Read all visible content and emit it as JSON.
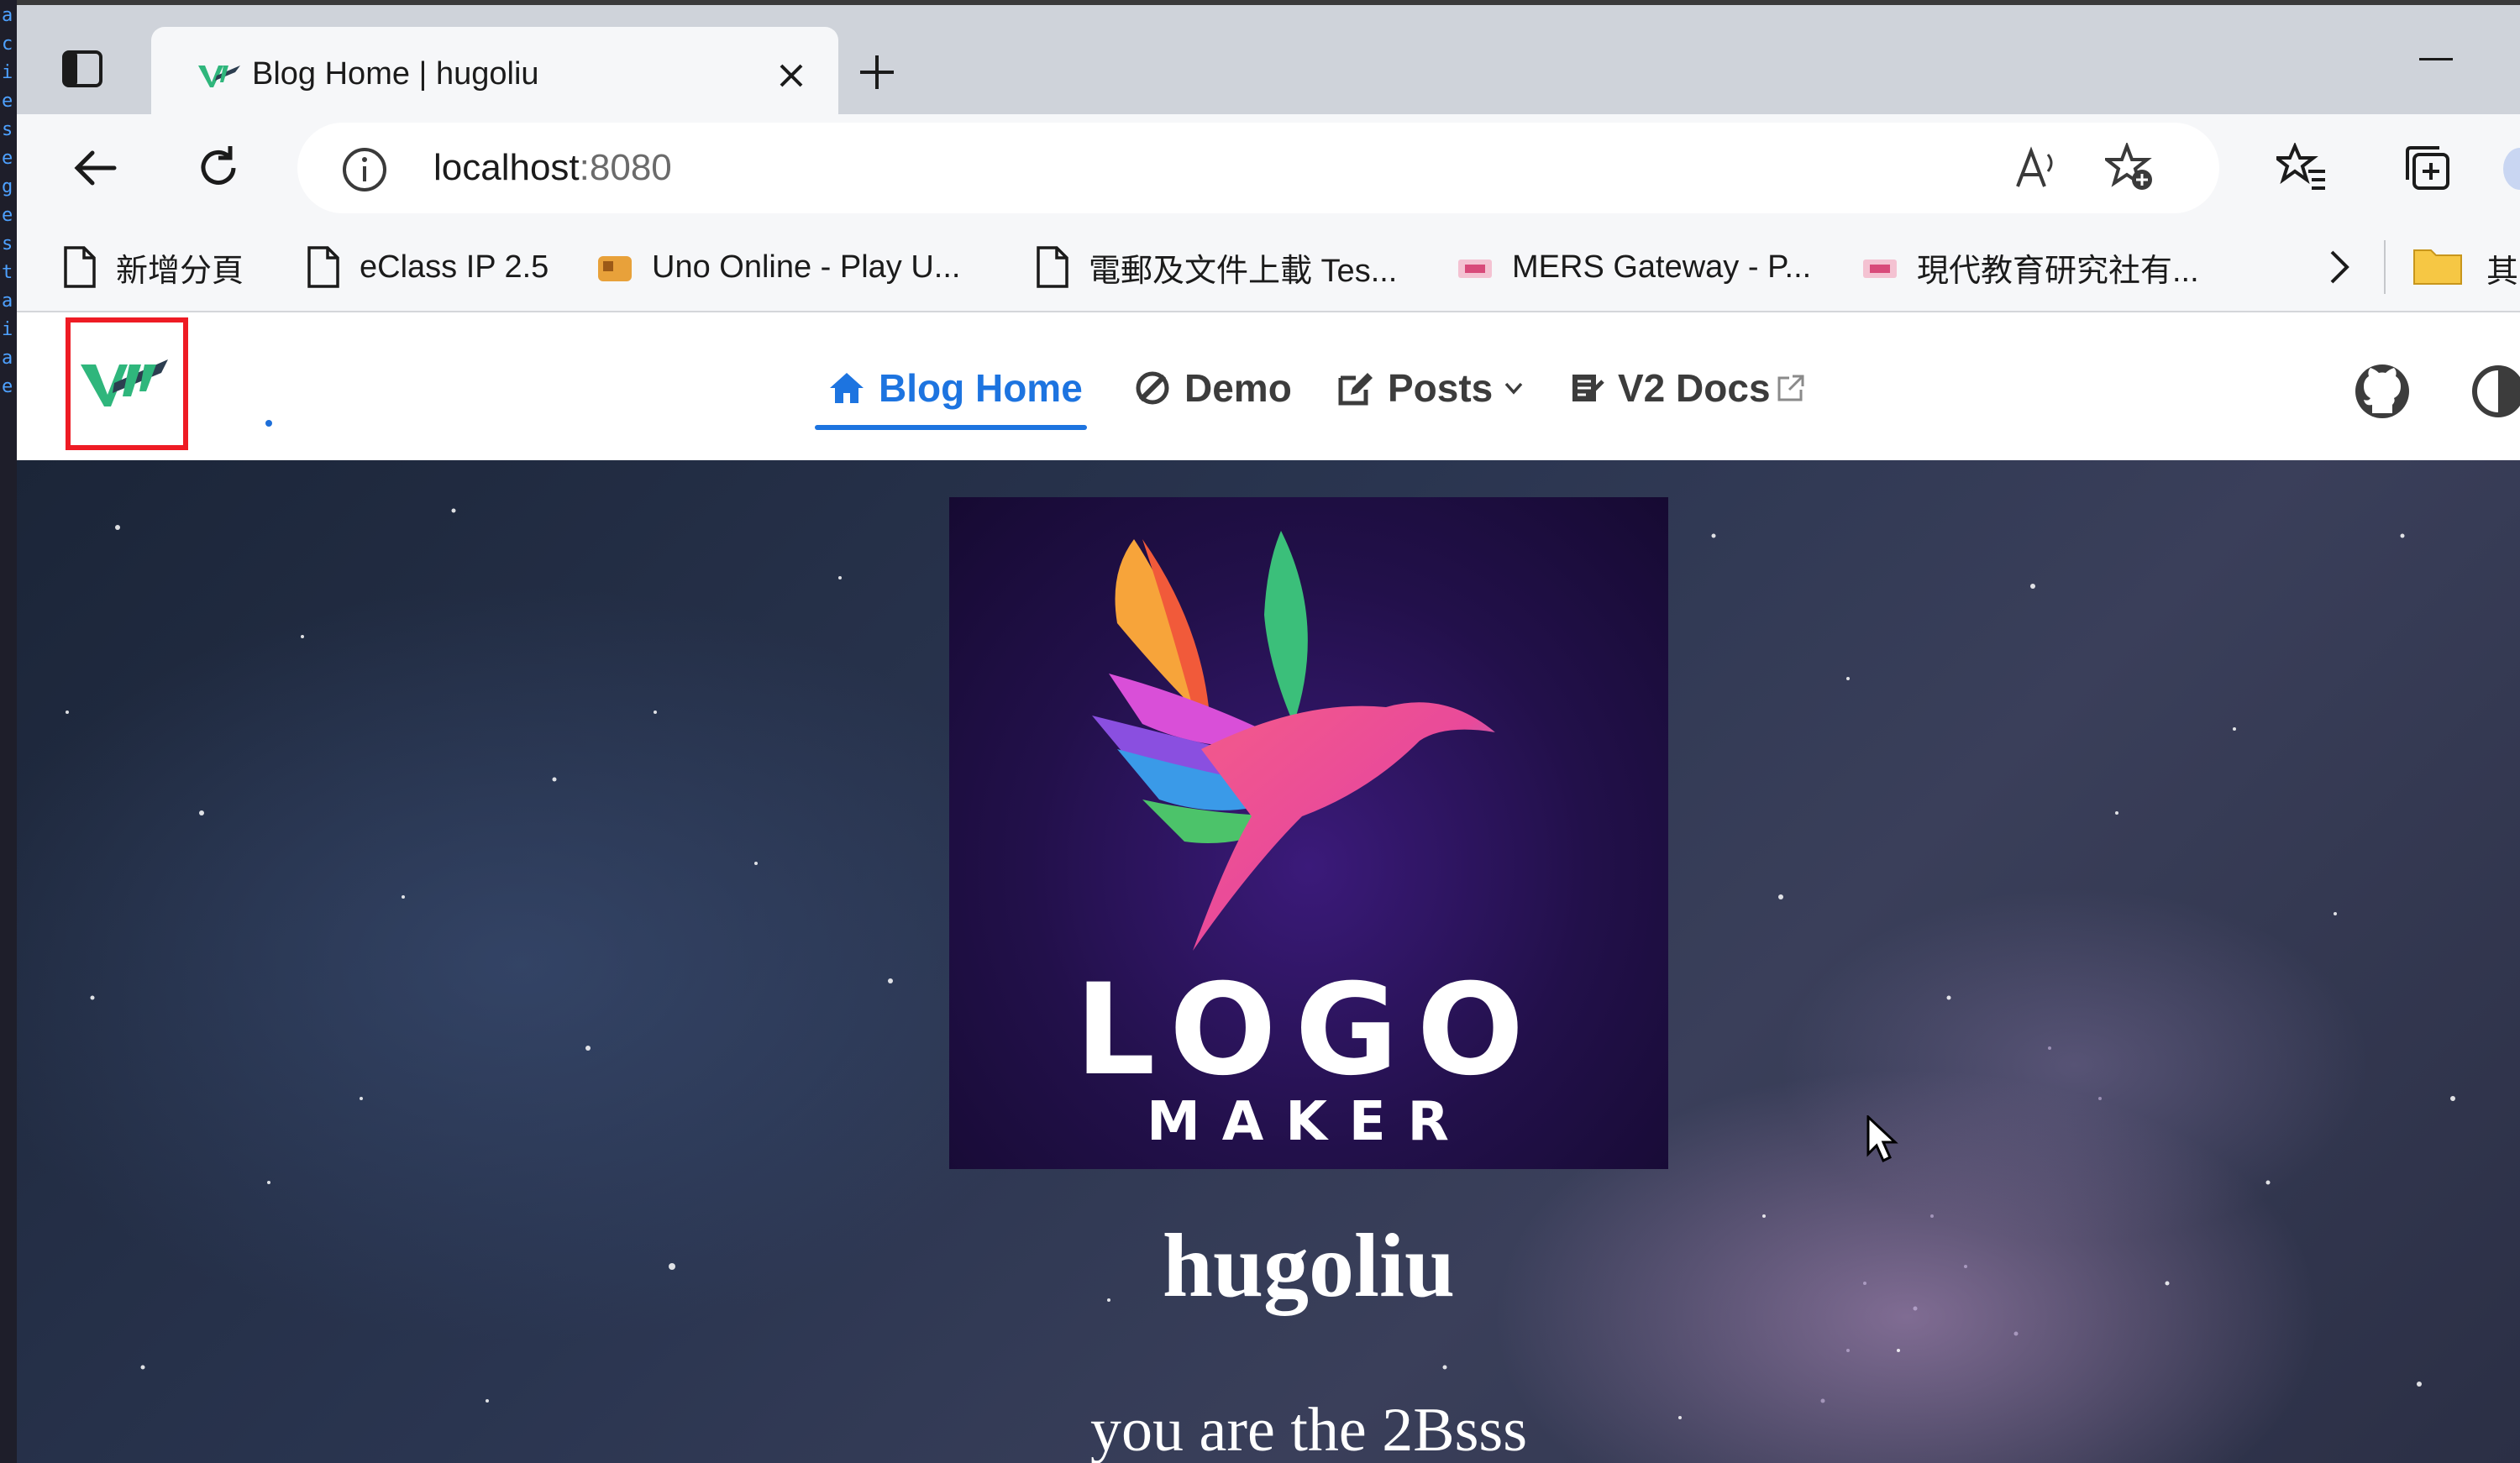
{
  "browser": {
    "tab": {
      "title": "Blog Home | hugoliu"
    },
    "address_bar": {
      "host": "localhost",
      "port": ":8080"
    },
    "bookmarks": [
      {
        "label": "新增分頁",
        "icon": "page-icon"
      },
      {
        "label": "eClass IP 2.5",
        "icon": "page-icon"
      },
      {
        "label": "Uno Online - Play U...",
        "icon": "game-favicon-icon"
      },
      {
        "label": "電郵及文件上載 Tes...",
        "icon": "page-icon"
      },
      {
        "label": "MERS Gateway - P...",
        "icon": "mers-favicon-icon"
      },
      {
        "label": "現代教育研究社有...",
        "icon": "mers-favicon-icon"
      }
    ],
    "bookmarks_overflow": "其"
  },
  "site": {
    "nav": [
      {
        "label": "Blog Home",
        "icon": "home-icon",
        "active": true
      },
      {
        "label": "Demo",
        "icon": "demo-icon"
      },
      {
        "label": "Posts",
        "icon": "edit-icon",
        "dropdown": true
      },
      {
        "label": "V2 Docs",
        "icon": "docs-icon",
        "external": true
      }
    ],
    "hero": {
      "logo_word": "LOGO",
      "logo_sub": "MAKER",
      "name": "hugoliu",
      "tagline": "you are the 2Bsss"
    }
  },
  "colors": {
    "accent": "#1d74e0",
    "highlight_box": "#ee1b24",
    "vuepress_green": "#2fb67c"
  }
}
